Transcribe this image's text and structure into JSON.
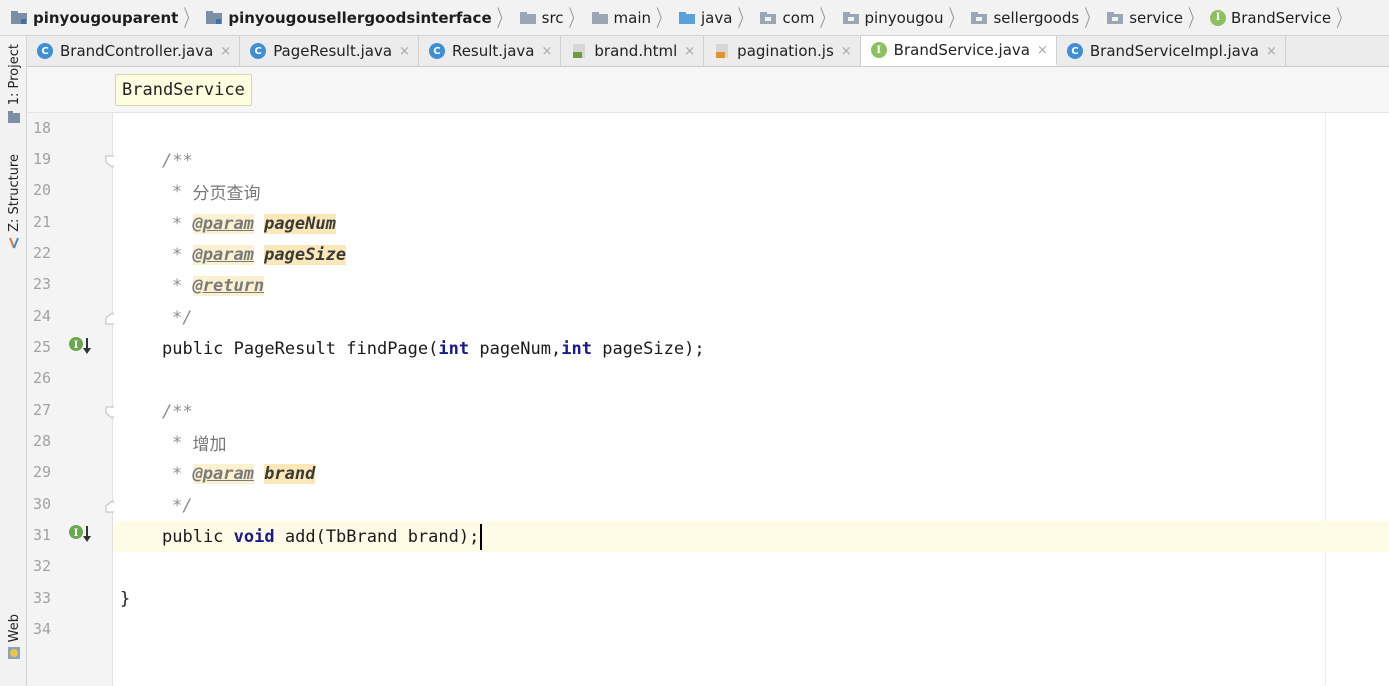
{
  "breadcrumb": {
    "items": [
      {
        "label": "pinyougouparent",
        "icon": "module-folder-icon",
        "bold": true
      },
      {
        "label": "pinyougousellergoodsinterface",
        "icon": "module-folder-icon",
        "bold": true
      },
      {
        "label": "src",
        "icon": "folder-icon",
        "bold": false
      },
      {
        "label": "main",
        "icon": "folder-icon",
        "bold": false
      },
      {
        "label": "java",
        "icon": "source-folder-icon",
        "bold": false
      },
      {
        "label": "com",
        "icon": "package-icon",
        "bold": false
      },
      {
        "label": "pinyougou",
        "icon": "package-icon",
        "bold": false
      },
      {
        "label": "sellergoods",
        "icon": "package-icon",
        "bold": false
      },
      {
        "label": "service",
        "icon": "package-icon",
        "bold": false
      },
      {
        "label": "BrandService",
        "icon": "interface-icon",
        "bold": false
      }
    ]
  },
  "left_tool_windows": {
    "project": "1: Project",
    "structure": "Z: Structure",
    "web": "Web"
  },
  "tabs": [
    {
      "label": "BrandController.java",
      "icon": "class-icon",
      "active": false
    },
    {
      "label": "PageResult.java",
      "icon": "class-icon",
      "active": false
    },
    {
      "label": "Result.java",
      "icon": "class-icon",
      "active": false
    },
    {
      "label": "brand.html",
      "icon": "html-file-icon",
      "active": false
    },
    {
      "label": "pagination.js",
      "icon": "js-file-icon",
      "active": false
    },
    {
      "label": "BrandService.java",
      "icon": "interface-icon",
      "active": true
    },
    {
      "label": "BrandServiceImpl.java",
      "icon": "class-icon",
      "active": false
    }
  ],
  "tab_close_glyph": "×",
  "sticky_header": "BrandService",
  "editor": {
    "line_numbers": [
      "18",
      "19",
      "20",
      "21",
      "22",
      "23",
      "24",
      "25",
      "26",
      "27",
      "28",
      "29",
      "30",
      "31",
      "32",
      "33",
      "34"
    ],
    "comment_open": "/**",
    "comment_close": "*/",
    "star": "*",
    "doc1_title": "分页查询",
    "doc2_title": "增加",
    "param_tag": "@param",
    "return_tag": "@return",
    "param_pageNum": "pageNum",
    "param_pageSize": "pageSize",
    "param_brand": "brand",
    "kw_public": "public",
    "kw_int": "int",
    "kw_void": "void",
    "line25_mid": "PageResult findPage(",
    "line25_a": "pageNum,",
    "line25_b": "pageSize);",
    "line31_rest": "add(TbBrand brand);",
    "closing_brace": "}"
  },
  "colors": {
    "keyword": "#1a1a8c",
    "comment": "#8c8c8c",
    "doc_tag_bg": "#fbe8b8",
    "caret_line": "#fffbe6",
    "class_icon": "#3f8fd5",
    "interface_icon": "#8cbf5f"
  }
}
